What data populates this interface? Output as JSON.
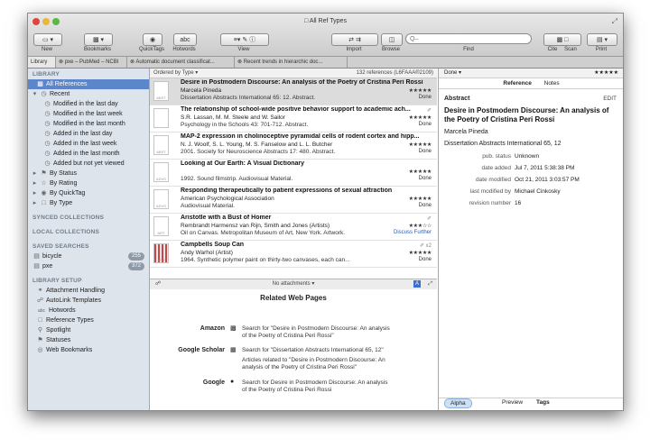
{
  "window": {
    "title": "All Ref Types"
  },
  "toolbar": {
    "new": "New",
    "bookmarks": "Bookmarks",
    "quicktags": "QuickTags",
    "hotwords": "Hotwords",
    "view": "View",
    "import": "Import",
    "browse": "Browse",
    "find": "Find",
    "cite": "Cite",
    "scan": "Scan",
    "print": "Print",
    "abc": "abc",
    "search_placeholder": "Q–"
  },
  "tabs": [
    "Library",
    "pxe – PubMed – NCBI",
    "Automatic document classificat...",
    "Recent trends in hierarchic doc..."
  ],
  "sidebar": {
    "library_head": "LIBRARY",
    "all_refs": "All References",
    "recent": "Recent",
    "recent_items": [
      "Modified in the last day",
      "Modified in the last week",
      "Modified in the last month",
      "Added in the last day",
      "Added in the last week",
      "Added in the last month",
      "Added but not yet viewed"
    ],
    "groups": [
      "By Status",
      "By Rating",
      "By QuickTag",
      "By Type"
    ],
    "synced": "SYNCED COLLECTIONS",
    "local": "LOCAL COLLECTIONS",
    "saved_head": "SAVED SEARCHES",
    "saved": [
      {
        "label": "bicycle",
        "count": "255"
      },
      {
        "label": "pxe",
        "count": "372"
      }
    ],
    "setup_head": "LIBRARY SETUP",
    "setup": [
      "Attachment Handling",
      "AutoLink Templates",
      "Hotwords",
      "Reference Types",
      "Spotlight",
      "Statuses",
      "Web Bookmarks"
    ]
  },
  "list": {
    "sort_label": "Ordered by Type ▾",
    "count": "132 references (L6FAAA®2109)",
    "rows": [
      {
        "thumb": "ABST",
        "title": "Desire in Postmodern Discourse: An analysis of the Poetry of Cristina Peri Rossi",
        "author": "Marcela Pineda",
        "source": "Dissertation Abstracts International 65: 12.  Abstract.",
        "stars": "★★★★★",
        "status": "Done",
        "clip": ""
      },
      {
        "thumb": "",
        "title": "The relationship of school-wide positive behavior support to academic ach...",
        "author": "S.R. Lassan, M. M. Steele and W. Sailor",
        "source": "Psychology in the Schools 43: 701-712.  Abstract.",
        "stars": "★★★★★",
        "status": "Done",
        "clip": "✐"
      },
      {
        "thumb": "ABST",
        "title": "MAP-2 expression in cholinoceptive pyramidal cells of rodent cortex and hipp...",
        "author": "N. J. Woolf, S. L. Young, M. S. Fanselow and L. L. Butcher",
        "source": "2001.  Society for Neuroscience Abstracts 17: 480.  Abstract.",
        "stars": "★★★★★",
        "status": "Done",
        "clip": ""
      },
      {
        "thumb": "ADVS",
        "title": "Looking at Our Earth: A Visual Dictionary",
        "author": "",
        "source": "1992.  Sound filmstrip.  Audiovisual Material.",
        "stars": "★★★★★",
        "status": "Done",
        "clip": ""
      },
      {
        "thumb": "ADVS",
        "title": "Responding therapeutically to patient expressions of sexual attraction",
        "author": "American Psychological Association",
        "source": "Audiovisual Material.",
        "stars": "★★★★★",
        "status": "Done",
        "clip": ""
      },
      {
        "thumb": "ART",
        "title": "Aristotle with a Bust of Homer",
        "author": "Rembrandt Harmensz van Rijn, Smith and Jones (Artists)",
        "source": "Oil on Canvas.  Metropolitan Museum of Art, New York.  Artwork.",
        "stars": "★★★☆☆",
        "status": "Discuss Further",
        "clip": "✐"
      },
      {
        "thumb": "ART",
        "title": "Campbells Soup Can",
        "author": "Andy Warhol (Artist)",
        "source": "1964.  Synthetic polymer paint on thirty-two canvases, each can...",
        "stars": "★★★★★",
        "status": "Done",
        "clip": "✐ x2"
      }
    ]
  },
  "attachments": {
    "label": "No attachments ▾"
  },
  "related": {
    "title": "Related Web Pages",
    "items": [
      {
        "label": "Amazon",
        "lines": [
          "Search for \"Desire in Postmodern Discourse: An analysis",
          "of the Poetry of Cristina Peri Rossi\""
        ]
      },
      {
        "label": "Google Scholar",
        "lines": [
          "Search for \"Dissertation Abstracts International 65, 12\"",
          "Articles related to \"Desire in Postmodern Discourse: An",
          "analysis of the Poetry of Cristina Peri Rossi\""
        ]
      },
      {
        "label": "Google",
        "lines": [
          "Search for Desire in Postmodern Discourse: An analysis",
          "of the Poetry of Cristina Peri Rossi"
        ]
      }
    ]
  },
  "detail": {
    "status": "Done ▾",
    "stars": "★★★★★",
    "tab_reference": "Reference",
    "tab_notes": "Notes",
    "type": "Abstract",
    "edit": "EDIT",
    "title": "Desire in Postmodern Discourse: An analysis of the Poetry of Cristina Peri Rossi",
    "author": "Marcela Pineda",
    "source": "Dissertation Abstracts International 65, 12",
    "fields": [
      {
        "label": "pub. status",
        "value": "Unknown"
      },
      {
        "label": "date added",
        "value": "Jul 7, 2011 5:38:38 PM"
      },
      {
        "label": "date modified",
        "value": "Oct 21, 2011 3:03:57 PM"
      },
      {
        "label": "last modified by",
        "value": "Michael Cinkosky"
      },
      {
        "label": "revision number",
        "value": "16"
      }
    ],
    "bottom_preview": "Preview",
    "bottom_tags": "Tags",
    "tag": "Alpha"
  }
}
